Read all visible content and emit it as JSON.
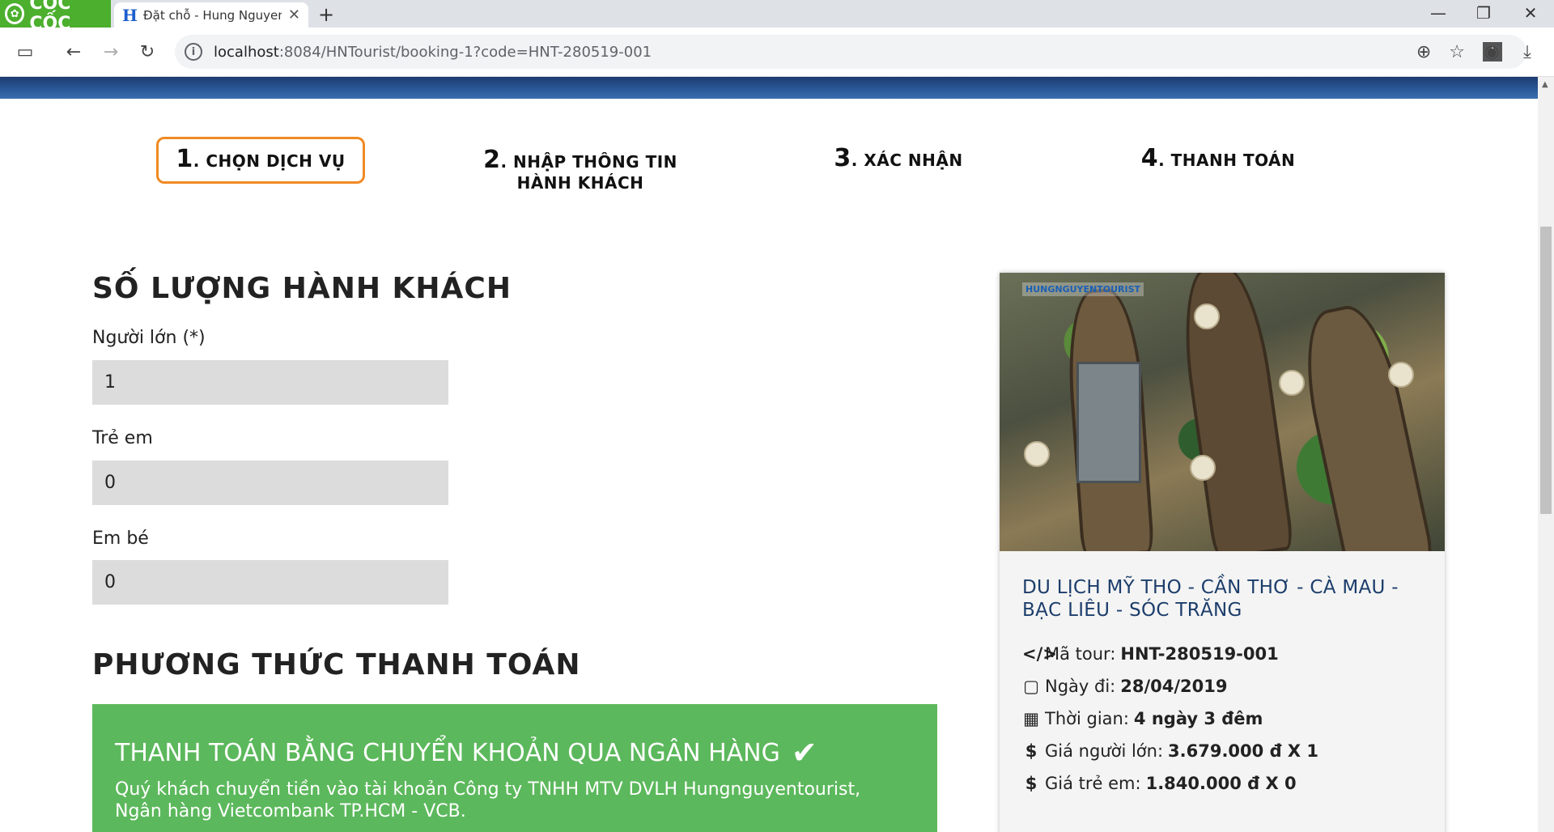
{
  "browser": {
    "brand": "CỐC CỐC",
    "tab_title": "Đặt chỗ - Hung Nguyen T",
    "url_host": "localhost",
    "url_path": ":8084/HNTourist/booking-1?code=HNT-280519-001"
  },
  "steps": [
    {
      "num": "1",
      "label": ". CHỌN DỊCH VỤ",
      "label2": ""
    },
    {
      "num": "2",
      "label": ". NHẬP THÔNG TIN",
      "label2": "HÀNH KHÁCH"
    },
    {
      "num": "3",
      "label": ". XÁC NHẬN",
      "label2": ""
    },
    {
      "num": "4",
      "label": ". THANH TOÁN",
      "label2": ""
    }
  ],
  "passengers": {
    "title": "SỐ LƯỢNG HÀNH KHÁCH",
    "adult_label": "Người lớn (*)",
    "adult_value": "1",
    "child_label": "Trẻ em",
    "child_value": "0",
    "infant_label": "Em bé",
    "infant_value": "0"
  },
  "payment": {
    "title": "PHƯƠNG THỨC THANH TOÁN",
    "method_title": "THANH TOÁN BẰNG CHUYỂN KHOẢN QUA NGÂN HÀNG",
    "method_desc": "Quý khách chuyển tiền vào tài khoản Công ty TNHH MTV DVLH Hungnguyentourist, Ngân hàng Vietcombank TP.HCM - VCB."
  },
  "tour": {
    "name": "DU LỊCH MỸ THO - CẦN THƠ - CÀ MAU - BẠC LIÊU - SÓC TRĂNG",
    "code_label": "Mã tour:",
    "code_value": "HNT-280519-001",
    "date_label": "Ngày đi:",
    "date_value": "28/04/2019",
    "duration_label": "Thời gian:",
    "duration_value": "4 ngày 3 đêm",
    "adult_price_label": "Giá người lớn:",
    "adult_price_value": "3.679.000 đ X 1",
    "child_price_label": "Giá trẻ em:",
    "child_price_value": "1.840.000 đ X 0",
    "image_logo": "HUNGNGUYENTOURIST"
  }
}
